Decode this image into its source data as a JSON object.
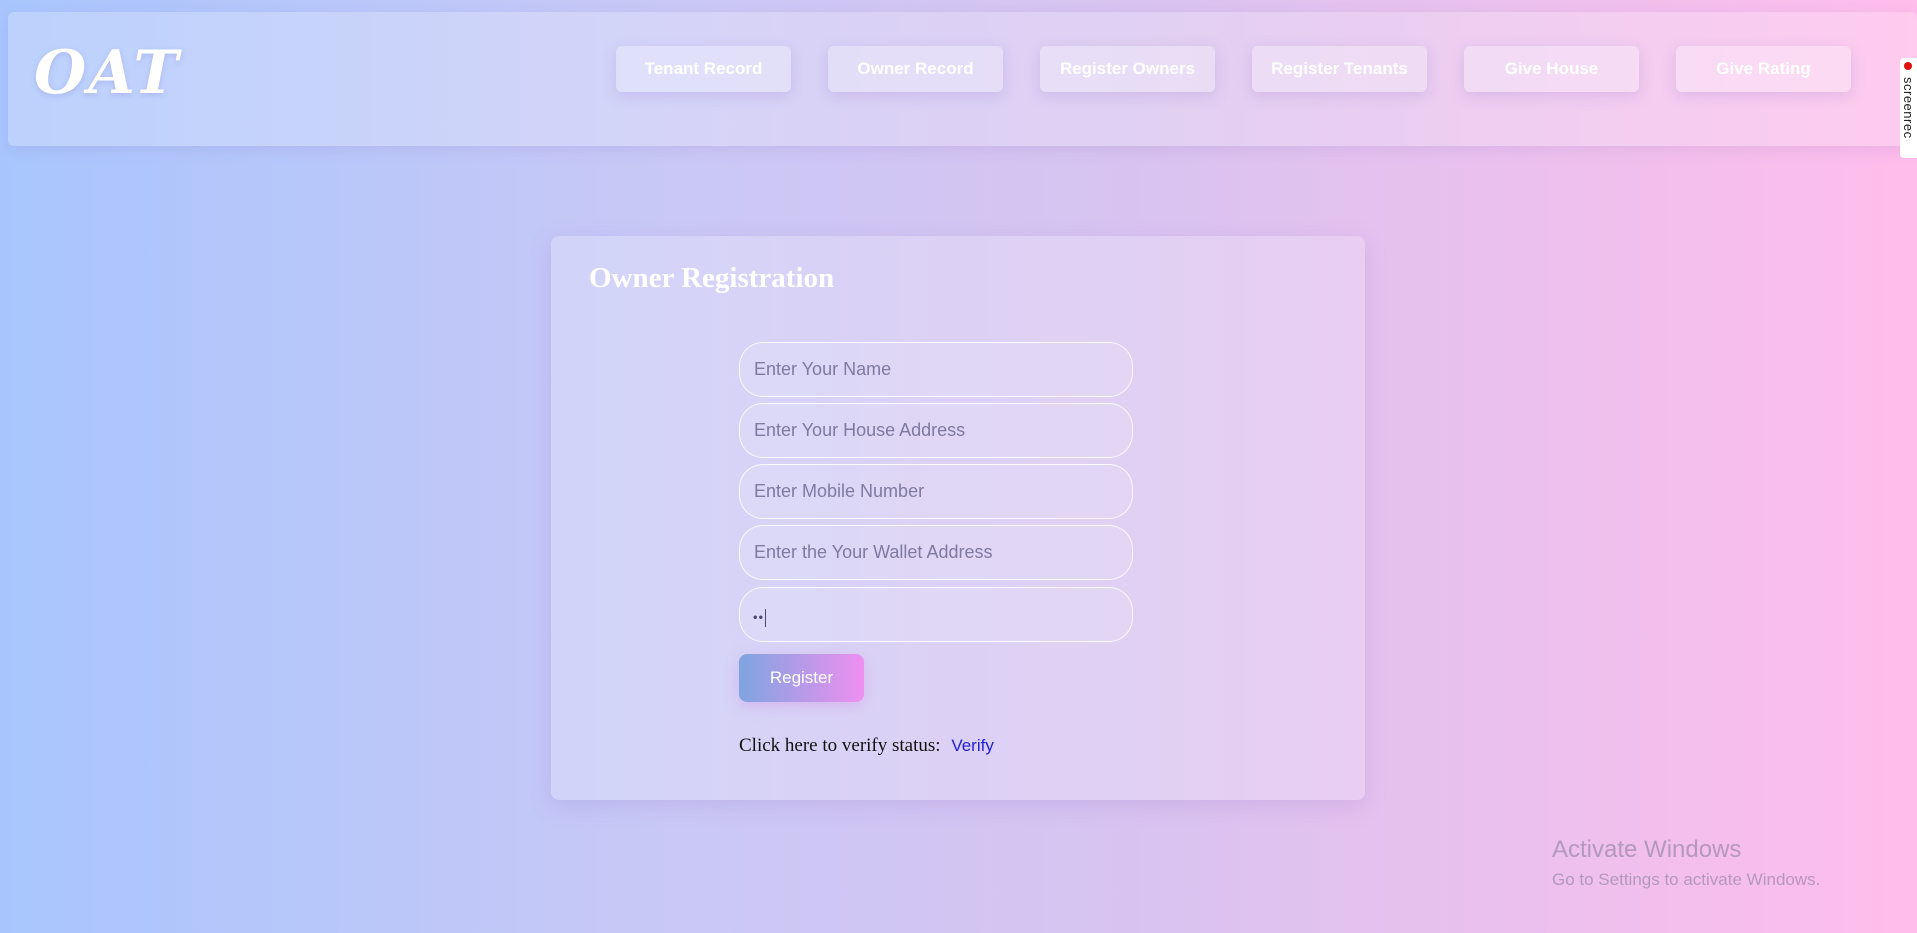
{
  "header": {
    "logo": "OAT",
    "nav": [
      {
        "label": "Tenant Record"
      },
      {
        "label": "Owner Record"
      },
      {
        "label": "Register Owners"
      },
      {
        "label": "Register Tenants"
      },
      {
        "label": "Give House"
      },
      {
        "label": "Give Rating"
      }
    ]
  },
  "screenrec": {
    "label": "screenrec"
  },
  "form": {
    "title": "Owner Registration",
    "fields": [
      {
        "placeholder": "Enter Your Name",
        "value": ""
      },
      {
        "placeholder": "Enter Your House Address",
        "value": ""
      },
      {
        "placeholder": "Enter Mobile Number",
        "value": ""
      },
      {
        "placeholder": "Enter the Your Wallet Address",
        "value": ""
      },
      {
        "placeholder": "",
        "value": "••"
      }
    ],
    "register_label": "Register",
    "verify_text": "Click here to verify status:",
    "verify_link": "Verify"
  },
  "watermark": {
    "title": "Activate Windows",
    "subtitle": "Go to Settings to activate Windows."
  },
  "colors": {
    "bg_start": "#a8c6fd",
    "bg_end": "#ffbdeb",
    "button_start": "#7ea5e0",
    "button_end": "#ee8ff0",
    "link": "#2020d8"
  }
}
